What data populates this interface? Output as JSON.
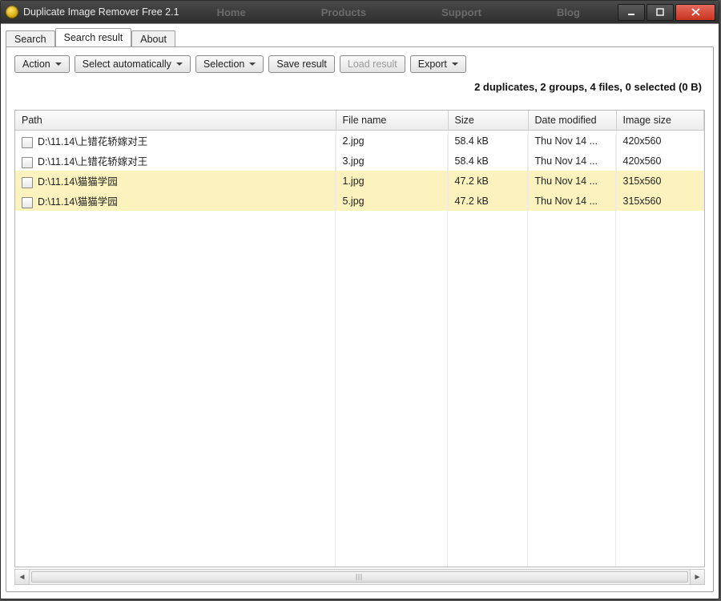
{
  "window": {
    "title": "Duplicate Image Remover Free 2.1",
    "ghost_menu": [
      "Home",
      "Products",
      "Support",
      "Blog"
    ]
  },
  "tabs": [
    {
      "label": "Search",
      "active": false
    },
    {
      "label": "Search result",
      "active": true
    },
    {
      "label": "About",
      "active": false
    }
  ],
  "toolbar": {
    "action": "Action",
    "select_auto": "Select automatically",
    "selection": "Selection",
    "save": "Save result",
    "load": "Load result",
    "export": "Export"
  },
  "status": "2 duplicates, 2 groups, 4 files, 0 selected (0 B)",
  "columns": {
    "path": "Path",
    "filename": "File name",
    "size": "Size",
    "date": "Date modified",
    "imagesize": "Image size"
  },
  "rows": [
    {
      "group": 0,
      "checked": false,
      "path": "D:\\11.14\\上错花轿嫁对王",
      "filename": "2.jpg",
      "size": "58.4 kB",
      "date": "Thu Nov 14 ...",
      "imagesize": "420x560"
    },
    {
      "group": 0,
      "checked": false,
      "path": "D:\\11.14\\上错花轿嫁对王",
      "filename": "3.jpg",
      "size": "58.4 kB",
      "date": "Thu Nov 14 ...",
      "imagesize": "420x560"
    },
    {
      "group": 1,
      "checked": false,
      "path": "D:\\11.14\\猫猫学园",
      "filename": "1.jpg",
      "size": "47.2 kB",
      "date": "Thu Nov 14 ...",
      "imagesize": "315x560"
    },
    {
      "group": 1,
      "checked": false,
      "path": "D:\\11.14\\猫猫学园",
      "filename": "5.jpg",
      "size": "47.2 kB",
      "date": "Thu Nov 14 ...",
      "imagesize": "315x560"
    }
  ],
  "colors": {
    "group_highlight": "#fbf2bd"
  }
}
